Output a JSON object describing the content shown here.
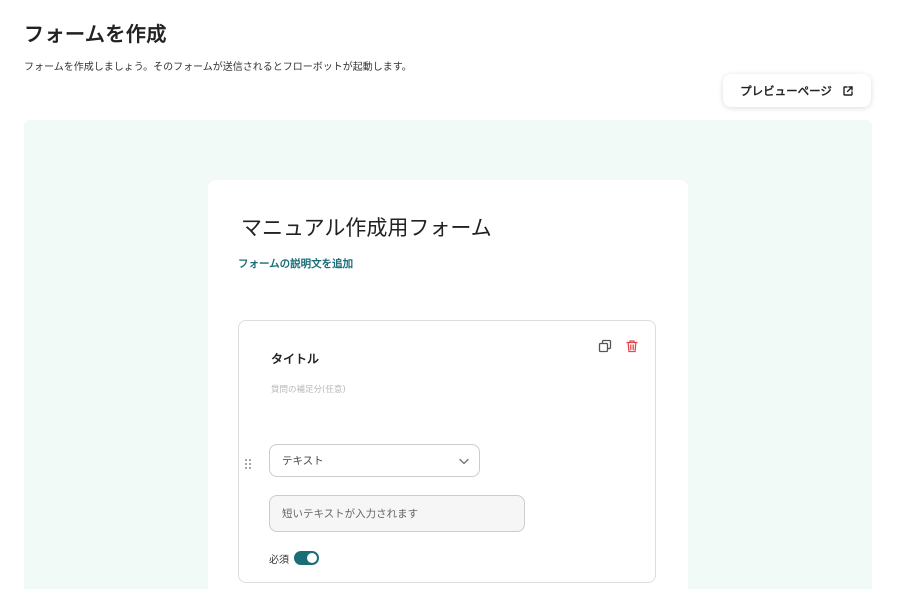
{
  "header": {
    "title": "フォームを作成",
    "description": "フォームを作成しましょう。そのフォームが送信されるとフローボットが起動します。",
    "preview_button_label": "プレビューページ",
    "preview_button_icon": "external-link-icon"
  },
  "form": {
    "title": "マニュアル作成用フォーム",
    "add_description_link": "フォームの説明文を追加"
  },
  "question": {
    "title": "タイトル",
    "hint": "質問の補足分(任意)",
    "type_selected": "テキスト",
    "answer_placeholder": "短いテキストが入力されます",
    "required_label": "必須",
    "required": true,
    "copy_icon": "copy-icon",
    "delete_icon": "trash-icon",
    "drag_icon": "drag-handle-icon"
  },
  "colors": {
    "accent": "#1a6e78",
    "canvas_background": "#f2faf8",
    "delete": "#e5484d"
  }
}
